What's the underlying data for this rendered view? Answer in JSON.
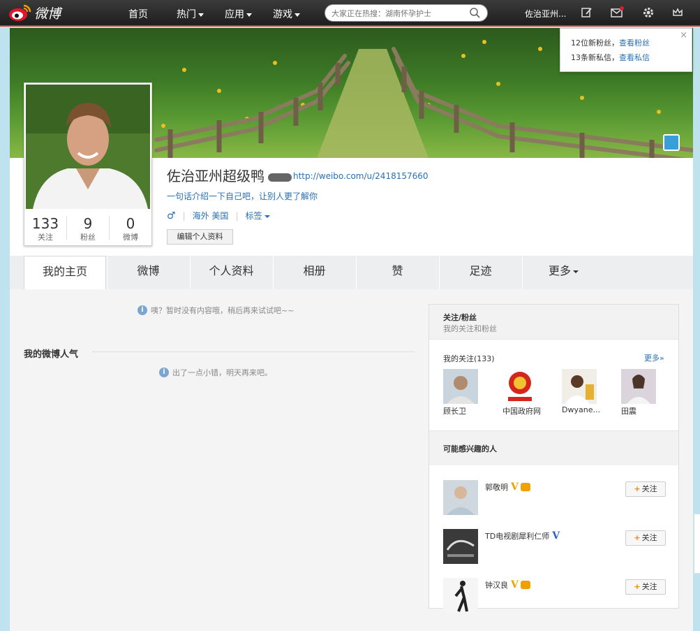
{
  "topbar": {
    "logo_text": "微博",
    "nav": [
      {
        "label": "首页",
        "caret": false
      },
      {
        "label": "热门",
        "caret": true
      },
      {
        "label": "应用",
        "caret": true
      },
      {
        "label": "游戏",
        "caret": true
      }
    ],
    "search_placeholder": "大家正在热搜：湖南怀孕护士",
    "user_name": "佐治亚州..."
  },
  "notification": {
    "fans_text": "12位新粉丝，",
    "fans_link": "查看粉丝",
    "msg_text": "13条新私信，",
    "msg_link": "查看私信",
    "close": "×"
  },
  "profile": {
    "name": "佐治亚州超级鸭",
    "url": "http://weibo.com/u/2418157660",
    "intro": "一句话介绍一下自己吧，让别人更了解你",
    "gender": "♂",
    "location": "海外 美国",
    "tags": "标签",
    "edit_button": "编辑个人资料",
    "stats": [
      {
        "num": "133",
        "label": "关注"
      },
      {
        "num": "9",
        "label": "粉丝"
      },
      {
        "num": "0",
        "label": "微博"
      }
    ]
  },
  "tabs": [
    "我的主页",
    "微博",
    "个人资料",
    "相册",
    "赞",
    "足迹",
    "更多"
  ],
  "main": {
    "empty_notice": "咦？暂时没有内容哦，稍后再来试试吧~~",
    "popularity_title": "我的微博人气",
    "error_notice": "出了一点小错，明天再来吧。"
  },
  "sidebar": {
    "follow_fans_title": "关注/粉丝",
    "follow_fans_sub": "我的关注和粉丝",
    "my_follows": "我的关注(133)",
    "more": "更多»",
    "follows": [
      {
        "name": "顾长卫"
      },
      {
        "name": "中国政府网"
      },
      {
        "name": "Dwyane..."
      },
      {
        "name": "田震"
      }
    ],
    "interest_title": "可能感兴趣的人",
    "follow_label": "关注",
    "recommendations": [
      {
        "name": "郭敬明",
        "badge_color": "#e8a400"
      },
      {
        "name": "TD电视剧犀利仁师",
        "badge_color": "#2b64c8"
      },
      {
        "name": "钟汉良",
        "badge_color": "#e8a400"
      }
    ]
  }
}
